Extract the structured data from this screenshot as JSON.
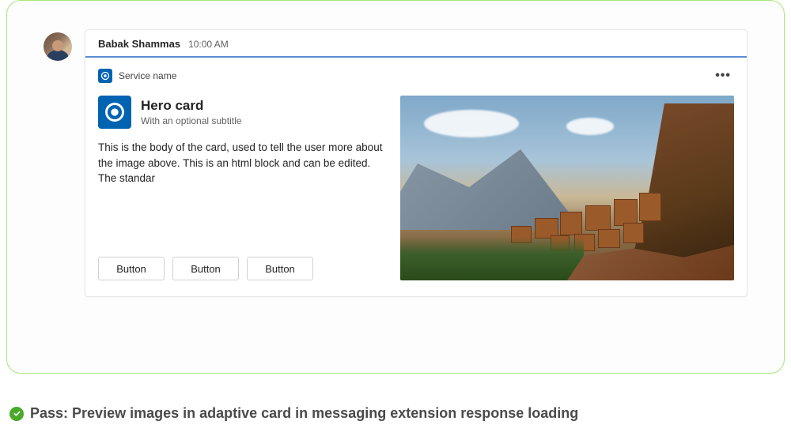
{
  "message": {
    "sender": "Babak Shammas",
    "timestamp": "10:00 AM"
  },
  "service": {
    "name": "Service name"
  },
  "hero": {
    "title": "Hero card",
    "subtitle": "With an optional subtitle",
    "body": "This is the body of the card, used to tell the user more about the image above. This is an html block and can be edited. The standar"
  },
  "buttons": [
    "Button",
    "Button",
    "Button"
  ],
  "pass": {
    "label": "Pass: Preview images in adaptive card in messaging extension response loading"
  }
}
